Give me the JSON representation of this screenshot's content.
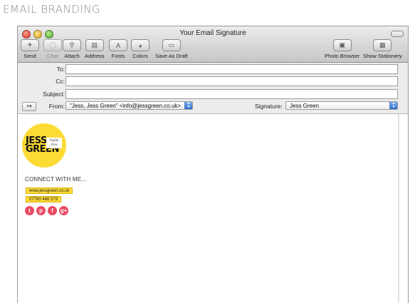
{
  "page": {
    "heading": "EMAIL BRANDING"
  },
  "window": {
    "title": "Your Email Signature"
  },
  "toolbar": {
    "buttons": [
      {
        "label": "Send",
        "icon": "send-icon",
        "glyph": "✈"
      },
      {
        "label": "Chat",
        "icon": "chat-icon",
        "glyph": "◯"
      },
      {
        "label": "Attach",
        "icon": "paperclip-icon",
        "glyph": "⚲"
      },
      {
        "label": "Address",
        "icon": "address-book-icon",
        "glyph": "▤"
      },
      {
        "label": "Fonts",
        "icon": "fonts-icon",
        "glyph": "A"
      },
      {
        "label": "Colors",
        "icon": "colors-icon",
        "glyph": "◕"
      },
      {
        "label": "Save As Draft",
        "icon": "draft-icon",
        "glyph": "▭"
      },
      {
        "label": "Photo Browser",
        "icon": "photo-browser-icon",
        "glyph": "▣"
      },
      {
        "label": "Show Stationery",
        "icon": "stationery-icon",
        "glyph": "▦"
      }
    ]
  },
  "headers": {
    "to_label": "To:",
    "cc_label": "Cc:",
    "subject_label": "Subject:",
    "from_label": "From:",
    "from_value": "\"Jess, Jess Green\" <info@jessgreen.co.uk>",
    "signature_label": "Signature:",
    "signature_value": "Jess Green"
  },
  "signature": {
    "logo_line1": "JESS",
    "logo_line2": "GREEN",
    "logo_tag": "Digital Diva",
    "connect": "CONNECT WITH ME...",
    "website": "www.jessgreen.co.uk",
    "phone": "07780 468 579",
    "social": [
      {
        "name": "twitter-icon",
        "glyph": "t"
      },
      {
        "name": "pinterest-icon",
        "glyph": "p"
      },
      {
        "name": "facebook-icon",
        "glyph": "f"
      },
      {
        "name": "google-plus-icon",
        "glyph": "g+"
      }
    ]
  },
  "colors": {
    "brand_yellow": "#fddb35",
    "social_pink": "#e84a62"
  }
}
